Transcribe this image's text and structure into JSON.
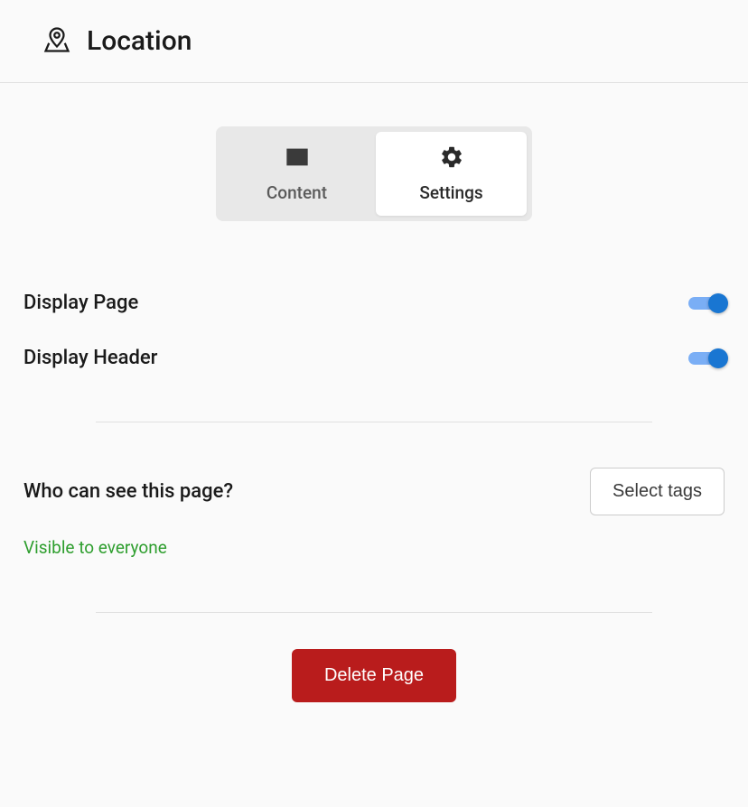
{
  "header": {
    "title": "Location"
  },
  "tabs": {
    "content": "Content",
    "settings": "Settings"
  },
  "settings": {
    "displayPage": {
      "label": "Display Page",
      "value": true
    },
    "displayHeader": {
      "label": "Display Header",
      "value": true
    }
  },
  "visibility": {
    "title": "Who can see this page?",
    "selectButton": "Select tags",
    "status": "Visible to everyone"
  },
  "actions": {
    "delete": "Delete Page"
  }
}
